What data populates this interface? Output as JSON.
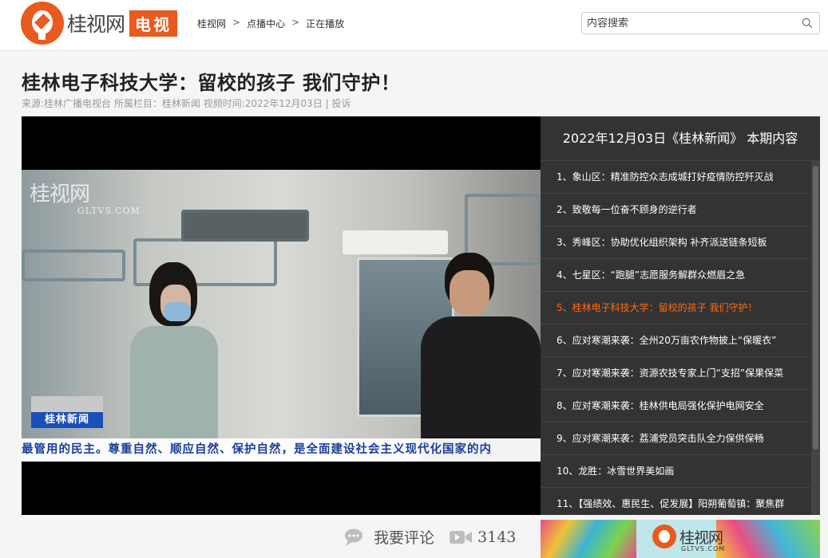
{
  "header": {
    "logo_text": "桂视网",
    "logo_badge": "电视",
    "breadcrumbs": [
      "桂视网",
      "点播中心",
      "正在播放"
    ],
    "breadcrumb_separator": ">",
    "search": {
      "placeholder": "内容搜索",
      "value": ""
    }
  },
  "video": {
    "title": "桂林电子科技大学：留校的孩子 我们守护！",
    "meta": "来源:桂林广播电视台 所属栏目：桂林新闻 视频时间:2022年12月03日 | 投诉",
    "watermark_name": "桂视网",
    "watermark_url": "GLTVS.COM",
    "program_logo": "桂林新闻",
    "ticker": "最管用的民主。尊重自然、顺应自然、保护自然，是全面建设社会主义现代化国家的内"
  },
  "playlist": {
    "heading": "2022年12月03日《桂林新闻》 本期内容",
    "items": [
      {
        "label": "1、象山区：精准防控众志成城打好疫情防控歼灭战"
      },
      {
        "label": "2、致敬每一位奋不顾身的逆行者"
      },
      {
        "label": "3、秀峰区：协助优化组织架构 补齐派送链条短板"
      },
      {
        "label": "4、七星区：“跑腿”志愿服务解群众燃眉之急"
      },
      {
        "label": "5、桂林电子科技大学：留校的孩子 我们守护！"
      },
      {
        "label": "6、应对寒潮来袭：全州20万亩农作物披上“保暖衣”"
      },
      {
        "label": "7、应对寒潮来袭：资源农技专家上门“支招”保果保菜"
      },
      {
        "label": "8、应对寒潮来袭：桂林供电局强化保护电网安全"
      },
      {
        "label": "9、应对寒潮来袭：荔浦党员突击队全力保供保畅"
      },
      {
        "label": "10、龙胜：冰雪世界美如画"
      },
      {
        "label": "11、【强绩效、惠民生、促发展】阳朔葡萄镇：聚焦群"
      }
    ],
    "active_index": 4,
    "active_color": "#ff6a13"
  },
  "actions": {
    "comment_label": "我要评论",
    "view_count": "3143"
  },
  "banner": {
    "name": "桂视网",
    "url": "GLTVS.COM"
  },
  "colors": {
    "brand": "#e85a1e",
    "playlist_bg": "#333333"
  }
}
